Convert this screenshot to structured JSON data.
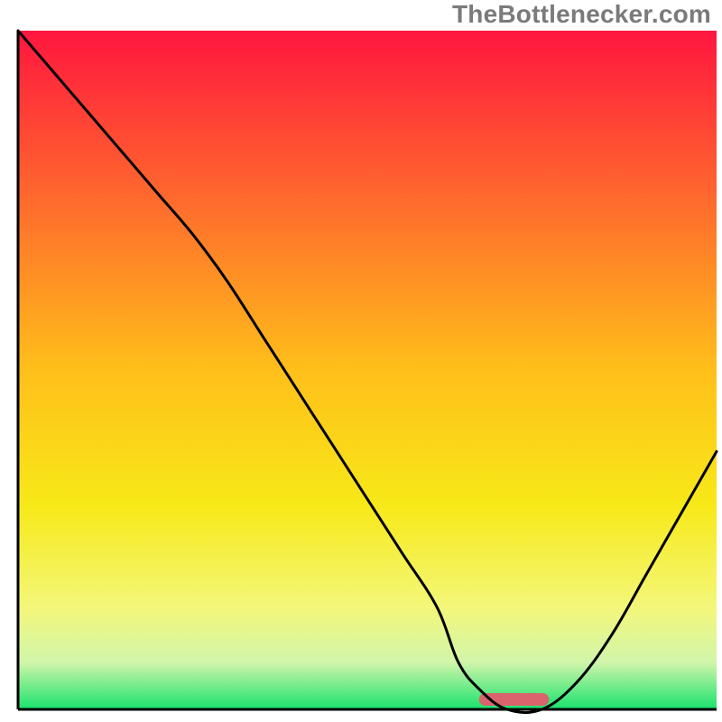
{
  "attribution": "TheBottlenecker.com",
  "chart_data": {
    "type": "line",
    "title": "",
    "xlabel": "",
    "ylabel": "",
    "xlim": [
      0,
      100
    ],
    "ylim": [
      0,
      100
    ],
    "x": [
      0,
      5,
      10,
      15,
      20,
      25,
      30,
      35,
      40,
      45,
      50,
      55,
      60,
      63,
      66,
      70,
      75,
      80,
      85,
      90,
      95,
      100
    ],
    "values": [
      100,
      94,
      88,
      82,
      76,
      70,
      63,
      55,
      47,
      39,
      31,
      23,
      15,
      7,
      3,
      0,
      0,
      4,
      11,
      20,
      29,
      38
    ],
    "optimum_range": {
      "start": 66,
      "end": 76,
      "value": 0
    },
    "gradient_stops": [
      {
        "pct": 0,
        "color": "#ff163f"
      },
      {
        "pct": 25,
        "color": "#ff6a2d"
      },
      {
        "pct": 50,
        "color": "#ffbf1a"
      },
      {
        "pct": 70,
        "color": "#f7e918"
      },
      {
        "pct": 85,
        "color": "#f3f77a"
      },
      {
        "pct": 93,
        "color": "#d2f5aa"
      },
      {
        "pct": 100,
        "color": "#19e36e"
      }
    ]
  }
}
